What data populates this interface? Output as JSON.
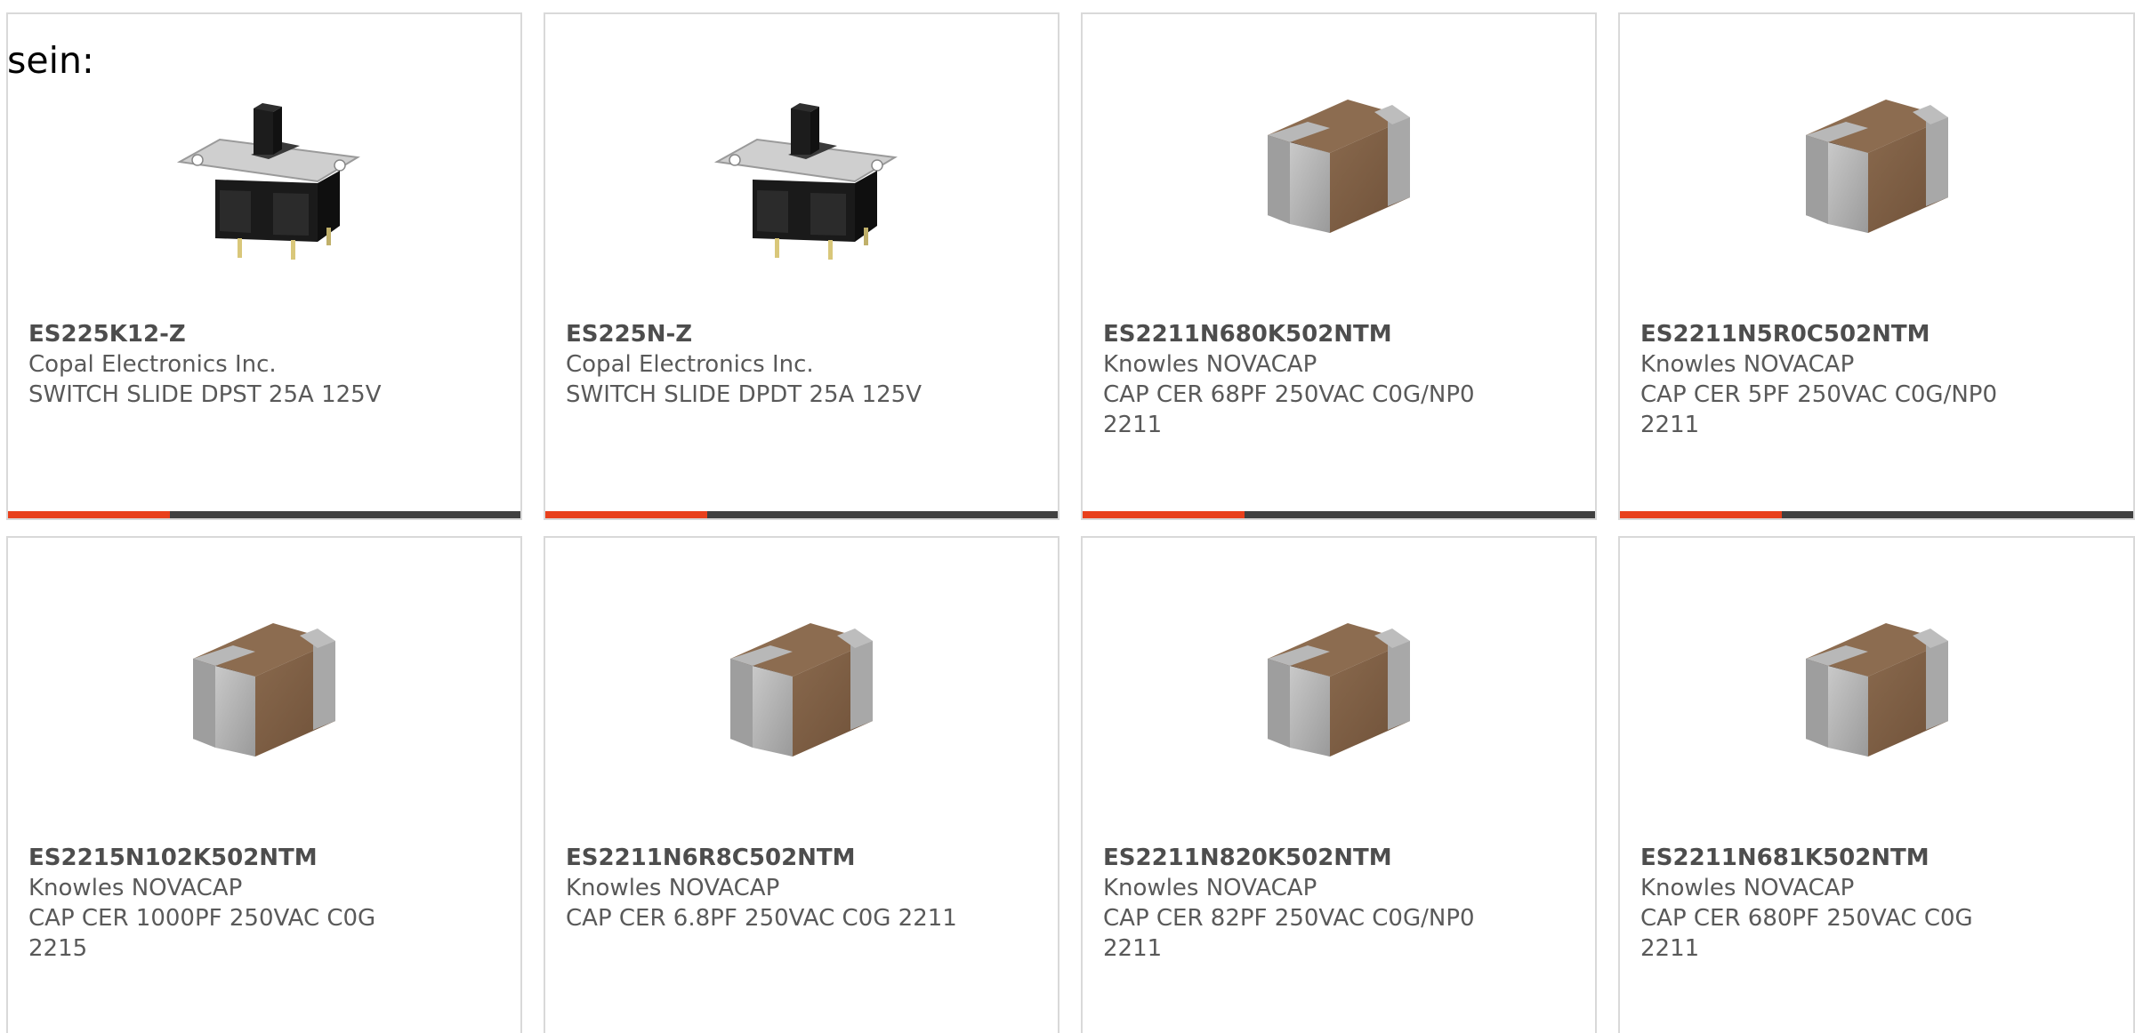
{
  "intro_text": "sein:",
  "colors": {
    "accent": "#e8401c",
    "bar": "#404040",
    "card_border": "#d9d9d9",
    "text": "#595959"
  },
  "products": [
    {
      "part_number": "ES225K12-Z",
      "manufacturer": "Copal Electronics Inc.",
      "description": "SWITCH SLIDE DPST 25A 125V",
      "image_icon": "slide-switch-image"
    },
    {
      "part_number": "ES225N-Z",
      "manufacturer": "Copal Electronics Inc.",
      "description": "SWITCH SLIDE DPDT 25A 125V",
      "image_icon": "slide-switch-image"
    },
    {
      "part_number": "ES2211N680K502NTM",
      "manufacturer": "Knowles NOVACAP",
      "description": "CAP CER 68PF 250VAC C0G/NP0\n2211",
      "image_icon": "ceramic-capacitor-image"
    },
    {
      "part_number": "ES2211N5R0C502NTM",
      "manufacturer": "Knowles NOVACAP",
      "description": "CAP CER 5PF 250VAC C0G/NP0\n2211",
      "image_icon": "ceramic-capacitor-image"
    },
    {
      "part_number": "ES2215N102K502NTM",
      "manufacturer": "Knowles NOVACAP",
      "description": "CAP CER 1000PF 250VAC C0G\n2215",
      "image_icon": "ceramic-capacitor-image"
    },
    {
      "part_number": "ES2211N6R8C502NTM",
      "manufacturer": "Knowles NOVACAP",
      "description": "CAP CER 6.8PF 250VAC C0G 2211",
      "image_icon": "ceramic-capacitor-image"
    },
    {
      "part_number": "ES2211N820K502NTM",
      "manufacturer": "Knowles NOVACAP",
      "description": "CAP CER 82PF 250VAC C0G/NP0\n2211",
      "image_icon": "ceramic-capacitor-image"
    },
    {
      "part_number": "ES2211N681K502NTM",
      "manufacturer": "Knowles NOVACAP",
      "description": "CAP CER 680PF 250VAC C0G\n2211",
      "image_icon": "ceramic-capacitor-image"
    }
  ]
}
